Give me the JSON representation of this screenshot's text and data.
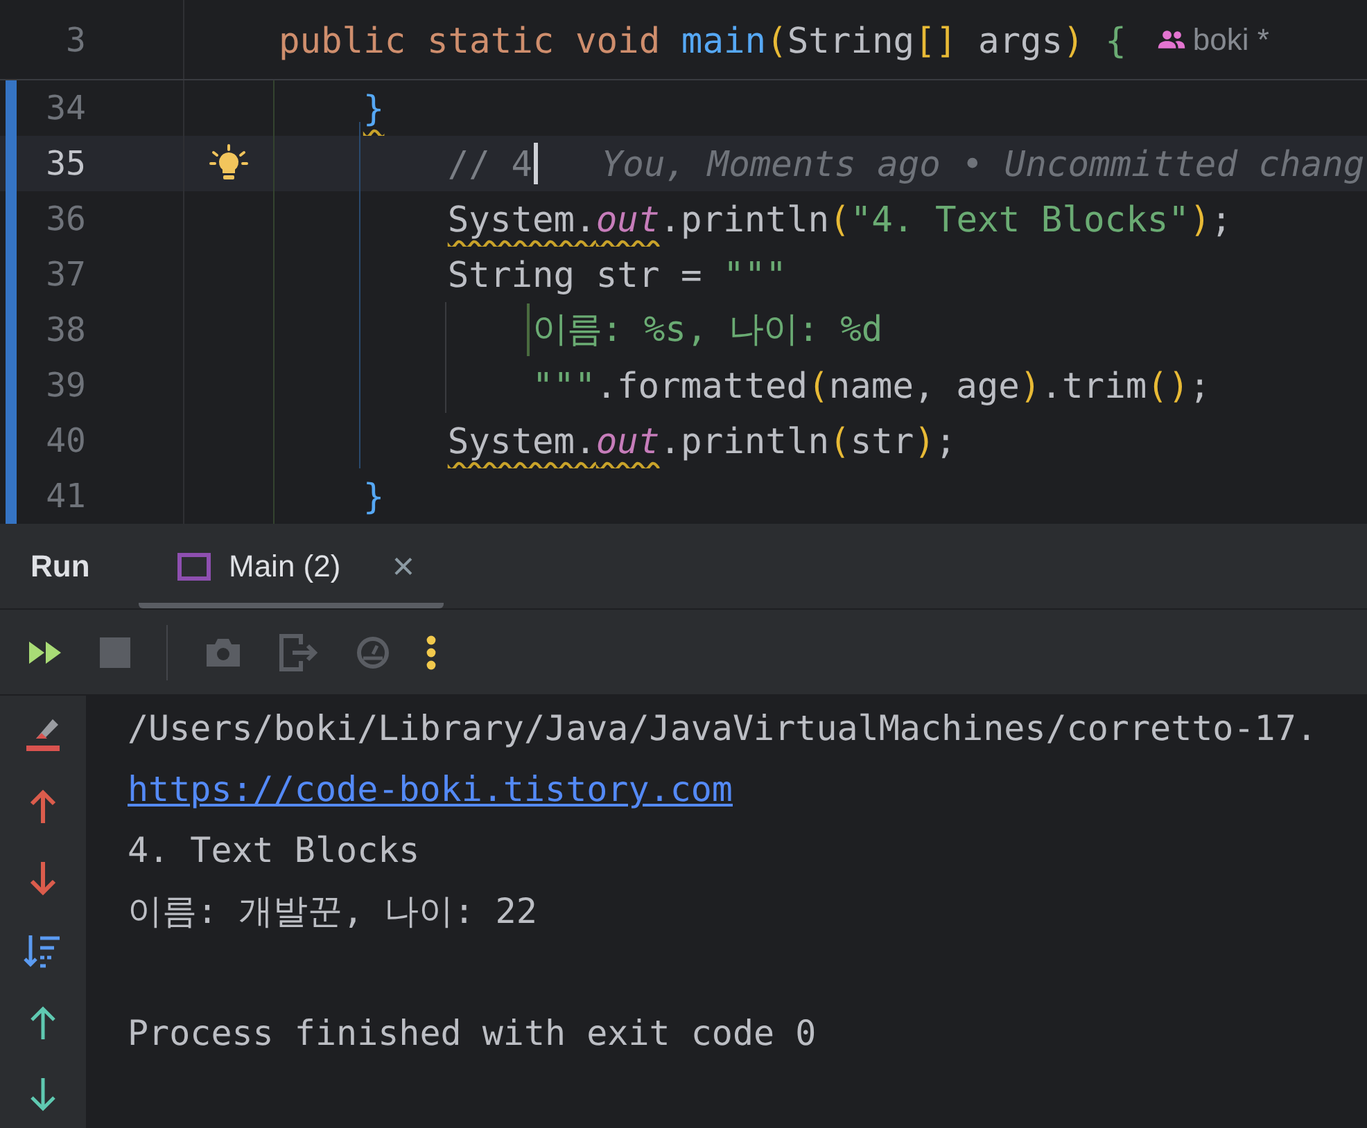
{
  "editor": {
    "sticky_line": {
      "number": "3",
      "tokens": [
        {
          "text": "public static void ",
          "kind": "keyword"
        },
        {
          "text": "main",
          "kind": "method"
        },
        {
          "text": "(",
          "kind": "bracket_gold"
        },
        {
          "text": "String",
          "kind": "plain"
        },
        {
          "text": "[]",
          "kind": "bracket_gold"
        },
        {
          "text": " args",
          "kind": "plain"
        },
        {
          "text": ")",
          "kind": "bracket_gold"
        },
        {
          "text": "{",
          "kind": "bracket_green"
        }
      ],
      "author": "boki *"
    },
    "lines": [
      {
        "number": "34",
        "current": false,
        "changed": true,
        "intention": false,
        "kind": "brace",
        "tokens": [
          {
            "text": "}",
            "kind": "bracket_blue",
            "warn": true
          }
        ]
      },
      {
        "number": "35",
        "current": true,
        "changed": true,
        "intention": true,
        "kind": "statement",
        "tokens": [
          {
            "text": "// 4",
            "kind": "comment"
          },
          {
            "kind": "caret"
          },
          {
            "text": "   You, Moments ago • Uncommitted chang",
            "kind": "inlay_hint"
          }
        ]
      },
      {
        "number": "36",
        "current": false,
        "changed": true,
        "intention": false,
        "kind": "statement",
        "tokens": [
          {
            "text": "System.",
            "kind": "plain",
            "warn": true
          },
          {
            "text": "out",
            "kind": "static_field",
            "warn": true
          },
          {
            "text": ".println",
            "kind": "plain"
          },
          {
            "text": "(",
            "kind": "bracket_gold"
          },
          {
            "text": "\"4. Text Blocks\"",
            "kind": "string"
          },
          {
            "text": ")",
            "kind": "bracket_gold"
          },
          {
            "text": ";",
            "kind": "plain"
          }
        ]
      },
      {
        "number": "37",
        "current": false,
        "changed": true,
        "intention": false,
        "kind": "statement",
        "tokens": [
          {
            "text": "String str = ",
            "kind": "plain"
          },
          {
            "text": "\"\"\"",
            "kind": "string"
          }
        ]
      },
      {
        "number": "38",
        "current": false,
        "changed": true,
        "intention": false,
        "kind": "text_block",
        "tokens": [
          {
            "kind": "block_margin"
          },
          {
            "text": "이름: %s, 나이: %d",
            "kind": "string"
          }
        ]
      },
      {
        "number": "39",
        "current": false,
        "changed": true,
        "intention": false,
        "kind": "text_block",
        "tokens": [
          {
            "text": "\"\"\"",
            "kind": "string"
          },
          {
            "text": ".formatted",
            "kind": "plain"
          },
          {
            "text": "(",
            "kind": "bracket_gold"
          },
          {
            "text": "name, age",
            "kind": "plain"
          },
          {
            "text": ")",
            "kind": "bracket_gold"
          },
          {
            "text": ".trim",
            "kind": "plain"
          },
          {
            "text": "()",
            "kind": "bracket_gold"
          },
          {
            "text": ";",
            "kind": "plain"
          }
        ]
      },
      {
        "number": "40",
        "current": false,
        "changed": true,
        "intention": false,
        "kind": "statement",
        "tokens": [
          {
            "text": "System.",
            "kind": "plain",
            "warn": true
          },
          {
            "text": "out",
            "kind": "static_field",
            "warn": true
          },
          {
            "text": ".println",
            "kind": "plain"
          },
          {
            "text": "(",
            "kind": "bracket_gold"
          },
          {
            "text": "str",
            "kind": "plain"
          },
          {
            "text": ")",
            "kind": "bracket_gold"
          },
          {
            "text": ";",
            "kind": "plain"
          }
        ]
      },
      {
        "number": "41",
        "current": false,
        "changed": true,
        "intention": false,
        "kind": "brace",
        "tokens": [
          {
            "text": "}",
            "kind": "bracket_blue"
          }
        ]
      }
    ]
  },
  "run_panel": {
    "title": "Run",
    "tabs": [
      {
        "label": "Main (2)",
        "selected": true,
        "close": "×"
      }
    ],
    "toolbar": [
      {
        "kind": "rerun",
        "disabled": false
      },
      {
        "kind": "stop",
        "disabled": true
      },
      {
        "kind": "separator"
      },
      {
        "kind": "camera",
        "disabled": true
      },
      {
        "kind": "exit",
        "disabled": true
      },
      {
        "kind": "gauge",
        "disabled": true
      },
      {
        "kind": "more",
        "disabled": false
      }
    ],
    "console": [
      {
        "kind": "text",
        "text": "/Users/boki/Library/Java/JavaVirtualMachines/corretto-17."
      },
      {
        "kind": "link",
        "text": "https://code-boki.tistory.com"
      },
      {
        "kind": "text",
        "text": "4. Text Blocks"
      },
      {
        "kind": "text",
        "text": "이름: 개발꾼, 나이: 22"
      },
      {
        "kind": "blank"
      },
      {
        "kind": "text",
        "text": "Process finished with exit code 0"
      }
    ]
  }
}
